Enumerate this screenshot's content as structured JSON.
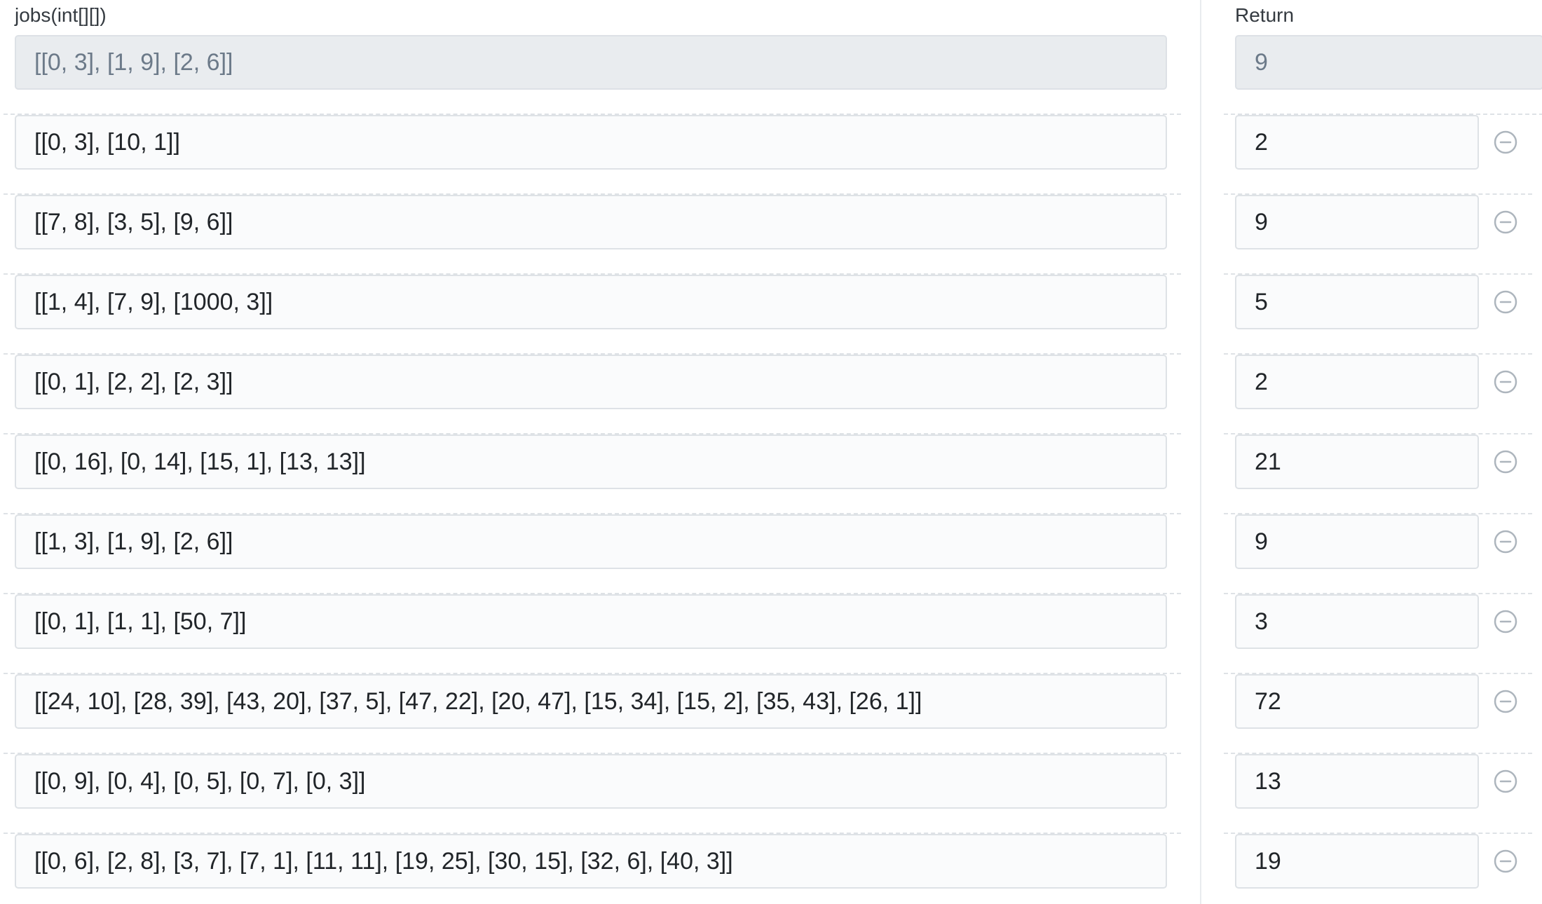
{
  "inputs": {
    "header": "jobs(int[][])",
    "example": "[[0, 3], [1, 9], [2, 6]]",
    "cases": [
      "[[0, 3], [10, 1]]",
      "[[7, 8], [3, 5], [9, 6]]",
      "[[1, 4], [7, 9], [1000, 3]]",
      "[[0, 1], [2, 2], [2, 3]]",
      "[[0, 16], [0, 14], [15, 1], [13, 13]]",
      "[[1, 3], [1, 9], [2, 6]]",
      "[[0, 1], [1, 1], [50, 7]]",
      "[[24, 10], [28, 39], [43, 20], [37, 5], [47, 22], [20, 47], [15, 34], [15, 2], [35, 43], [26, 1]]",
      "[[0, 9], [0, 4], [0, 5], [0, 7], [0, 3]]",
      "[[0, 6], [2, 8], [3, 7], [7, 1], [11, 11], [19, 25], [30, 15], [32, 6], [40, 3]]"
    ]
  },
  "returns": {
    "header": "Return",
    "example": "9",
    "cases": [
      "2",
      "9",
      "5",
      "2",
      "21",
      "9",
      "3",
      "72",
      "13",
      "19"
    ]
  },
  "icons": {
    "remove": "minus-circle-icon"
  },
  "colors": {
    "field_background": "#fafbfc",
    "readonly_background": "#e9ecef",
    "border": "#dee2e6",
    "icon": "#adb5bd"
  }
}
